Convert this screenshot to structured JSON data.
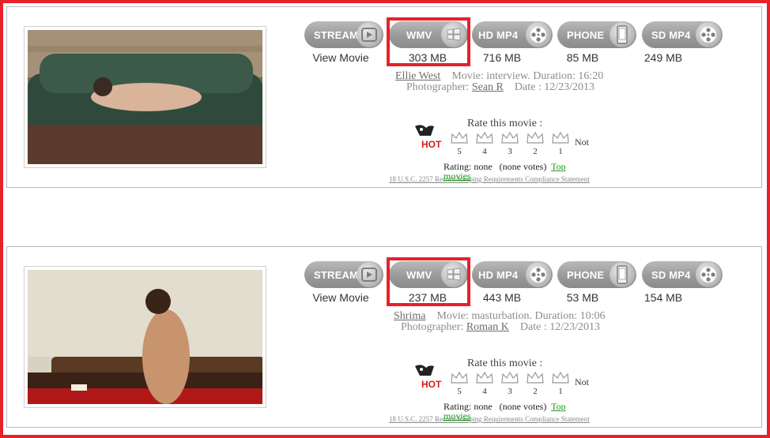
{
  "formats": {
    "stream": "STREAM",
    "wmv": "WMV",
    "hd_mp4": "HD MP4",
    "phone": "PHONE",
    "sd_mp4": "SD MP4"
  },
  "movies": [
    {
      "view_movie": "View Movie",
      "sizes": {
        "wmv": "303 MB",
        "hd_mp4": "716 MB",
        "phone": "85 MB",
        "sd_mp4": "249 MB"
      },
      "model": "Ellie West",
      "movie_line": "Movie: interview. Duration: 16:20",
      "photographer_label": "Photographer:",
      "photographer": "Sean R",
      "date": "Date : 12/23/2013",
      "rate_title": "Rate this movie :",
      "crowns": [
        "5",
        "4",
        "3",
        "2",
        "1"
      ],
      "not_label": "Not",
      "hot_label": "HOT",
      "rating": "Rating: none",
      "votes": "(none votes)",
      "top": "Top",
      "movies_link": "movies",
      "compliance": "18 U.S.C. 2257 Record-Keeping Requirements Compliance Statement"
    },
    {
      "view_movie": "View Movie",
      "sizes": {
        "wmv": "237 MB",
        "hd_mp4": "443 MB",
        "phone": "53 MB",
        "sd_mp4": "154 MB"
      },
      "model": "Shrima",
      "movie_line": "Movie: masturbation. Duration: 10:06",
      "photographer_label": "Photographer:",
      "photographer": "Roman K",
      "date": "Date : 12/23/2013",
      "rate_title": "Rate this movie :",
      "crowns": [
        "5",
        "4",
        "3",
        "2",
        "1"
      ],
      "not_label": "Not",
      "hot_label": "HOT",
      "rating": "Rating: none",
      "votes": "(none votes)",
      "top": "Top",
      "movies_link": "movies",
      "compliance": "18 U.S.C. 2257 Record-Keeping Requirements Compliance Statement"
    }
  ],
  "colors": {
    "highlight": "#e8202a",
    "button": "#9a9a9a",
    "link_green": "#1a9a1a"
  },
  "icons": [
    "play-icon",
    "windows-icon",
    "film-reel-icon",
    "phone-icon",
    "crown-icon",
    "hot-badge-icon"
  ]
}
